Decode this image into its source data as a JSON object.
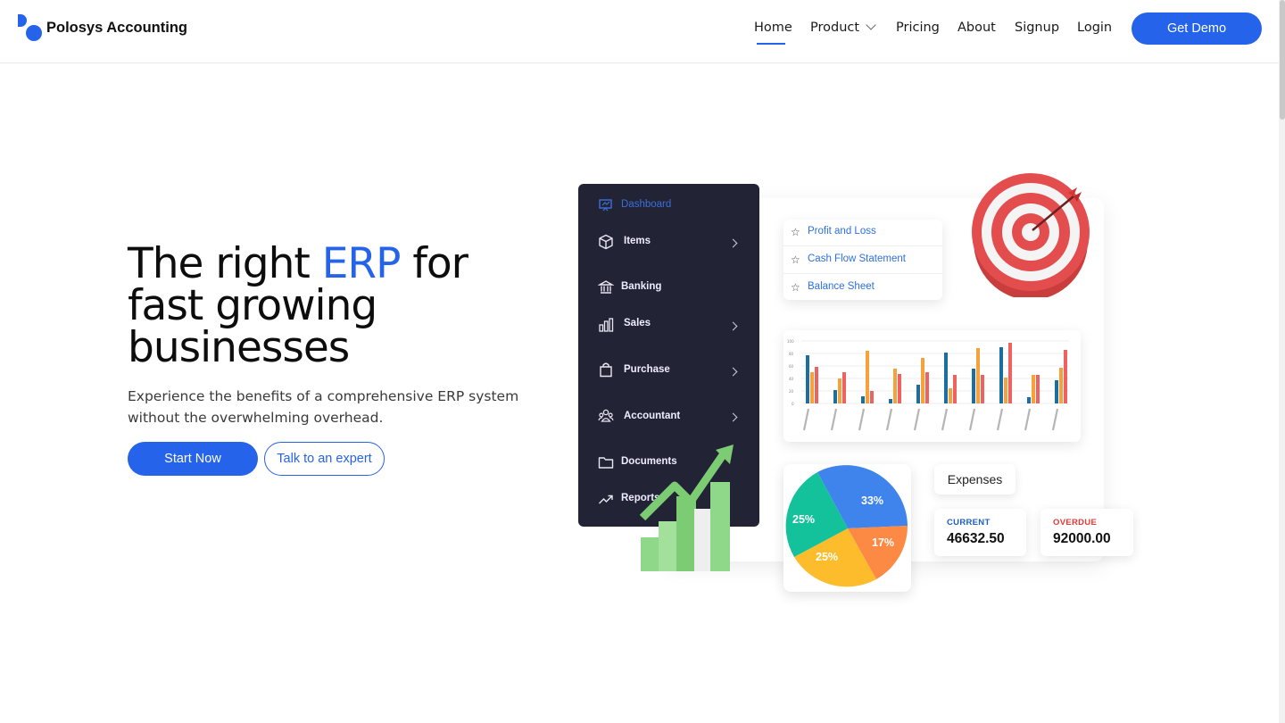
{
  "brand": {
    "name": "Polosys Accounting",
    "color": "#2563eb"
  },
  "nav": {
    "items": [
      "Home",
      "Product",
      "Pricing",
      "About",
      "Signup",
      "Login"
    ],
    "active": "Home",
    "cta": "Get Demo"
  },
  "hero": {
    "title_part1": "The right ",
    "title_accent": "ERP",
    "title_part2": " for fast growing businesses",
    "subtitle": "Experience the benefits of a comprehensive ERP system without the overwhelming overhead.",
    "primary_button": "Start Now",
    "secondary_button": "Talk to an expert"
  },
  "dashboard": {
    "sidebar": [
      "Dashboard",
      "Items",
      "Banking",
      "Sales",
      "Purchase",
      "Accountant",
      "Documents",
      "Reports"
    ],
    "reports": [
      "Profit and Loss",
      "Cash Flow Statement",
      "Balance Sheet"
    ],
    "pie_labels": [
      "33%",
      "17%",
      "25%",
      "25%"
    ],
    "expenses_label": "Expenses",
    "current_label": "CURRENT",
    "current_value": "46632.50",
    "overdue_label": "OVERDUE",
    "overdue_value": "92000.00"
  },
  "colors": {
    "sidebar_bg": "#232336",
    "overdue": "#e53935",
    "current": "#1f5fbf"
  },
  "icons": [
    "dashboard-icon",
    "cube-icon",
    "bank-icon",
    "bar-chart-icon",
    "bag-icon",
    "users-icon",
    "folder-icon",
    "trend-icon",
    "star-icon",
    "chevron-down-icon",
    "target-icon"
  ]
}
